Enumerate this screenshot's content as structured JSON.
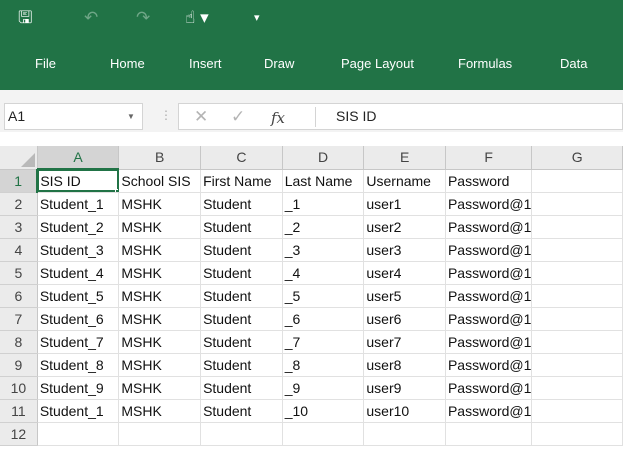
{
  "quick_access": {
    "save_icon": "🖫",
    "undo_icon": "↶",
    "redo_icon": "↷",
    "touch_icon": "☝ ▾",
    "customize_icon": "▾"
  },
  "ribbon": {
    "tabs": [
      "File",
      "Home",
      "Insert",
      "Draw",
      "Page Layout",
      "Formulas",
      "Data"
    ]
  },
  "formula_bar": {
    "name_box": "A1",
    "cancel_icon": "✕",
    "enter_icon": "✓",
    "fx_icon": "fx",
    "content": "SIS ID"
  },
  "sheet": {
    "columns": [
      "A",
      "B",
      "C",
      "D",
      "E",
      "F",
      "G"
    ],
    "selected_cell": "A1",
    "rows": [
      [
        "SIS ID",
        "School SIS",
        "First Name",
        "Last Name",
        "Username",
        "Password",
        ""
      ],
      [
        "Student_1",
        "MSHK",
        "Student",
        "_1",
        "user1",
        "Password@1",
        ""
      ],
      [
        "Student_2",
        "MSHK",
        "Student",
        "_2",
        "user2",
        "Password@1",
        ""
      ],
      [
        "Student_3",
        "MSHK",
        "Student",
        "_3",
        "user3",
        "Password@1",
        ""
      ],
      [
        "Student_4",
        "MSHK",
        "Student",
        "_4",
        "user4",
        "Password@1",
        ""
      ],
      [
        "Student_5",
        "MSHK",
        "Student",
        "_5",
        "user5",
        "Password@1",
        ""
      ],
      [
        "Student_6",
        "MSHK",
        "Student",
        "_6",
        "user6",
        "Password@1",
        ""
      ],
      [
        "Student_7",
        "MSHK",
        "Student",
        "_7",
        "user7",
        "Password@1",
        ""
      ],
      [
        "Student_8",
        "MSHK",
        "Student",
        "_8",
        "user8",
        "Password@1",
        ""
      ],
      [
        "Student_9",
        "MSHK",
        "Student",
        "_9",
        "user9",
        "Password@1",
        ""
      ],
      [
        "Student_1",
        "MSHK",
        "Student",
        "_10",
        "user10",
        "Password@1",
        ""
      ],
      [
        "",
        "",
        "",
        "",
        "",
        "",
        ""
      ]
    ]
  },
  "colors": {
    "accent": "#217346"
  }
}
